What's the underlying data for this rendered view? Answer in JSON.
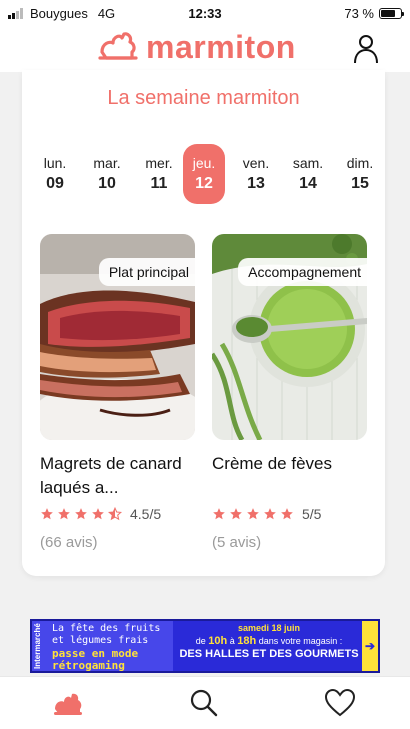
{
  "status_bar": {
    "carrier": "Bouygues",
    "network": "4G",
    "time": "12:33",
    "battery": "73 %",
    "battery_level": 0.73
  },
  "header": {
    "brand": "marmiton",
    "logo_icon": "chef-hat-logo-icon",
    "user_icon": "user-icon"
  },
  "week": {
    "title": "La semaine marmiton",
    "days": [
      {
        "name": "lun.",
        "num": "09"
      },
      {
        "name": "mar.",
        "num": "10"
      },
      {
        "name": "mer.",
        "num": "11"
      },
      {
        "name": "jeu.",
        "num": "12"
      },
      {
        "name": "ven.",
        "num": "13"
      },
      {
        "name": "sam.",
        "num": "14"
      },
      {
        "name": "dim.",
        "num": "15"
      }
    ],
    "selected_day": "jeu. 12",
    "accent_color": "#f0706a"
  },
  "recipes": [
    {
      "tag": "Plat principal",
      "name": "Magrets de canard laqués a...",
      "rating": 4.5,
      "rating_text": "4.5/5",
      "reviews": "(66 avis)"
    },
    {
      "tag": "Accompagnement",
      "name": "Crème de fèves",
      "rating": 5,
      "rating_text": "5/5",
      "reviews": "(5 avis)"
    }
  ],
  "ad": {
    "brand": "Intermarché",
    "line1": "La fête des fruits",
    "line2": "et légumes frais",
    "line3": "passe en mode",
    "line4": "rétrogaming",
    "date": "samedi 18 juin",
    "hours_pre": "de",
    "hours_from": "10h",
    "hours_mid": "à",
    "hours_to": "18h",
    "hours_post": "dans votre magasin :",
    "store": "DES HALLES ET DES GOURMETS",
    "arrow": "➔"
  },
  "tabbar": {
    "items": [
      {
        "icon": "chef-hat-icon",
        "active": true
      },
      {
        "icon": "search-icon",
        "active": false
      },
      {
        "icon": "heart-icon",
        "active": false
      }
    ]
  }
}
